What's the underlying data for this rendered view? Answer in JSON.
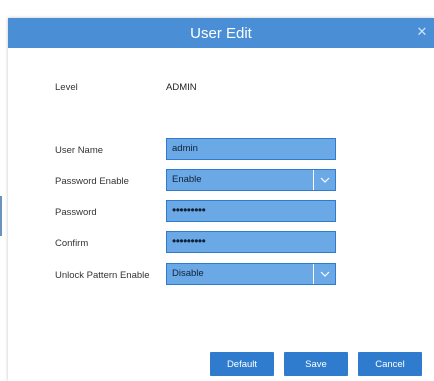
{
  "dialog": {
    "title": "User Edit",
    "close_glyph": "✕"
  },
  "form": {
    "level": {
      "label": "Level",
      "value": "ADMIN"
    },
    "user_name": {
      "label": "User Name",
      "value": "admin"
    },
    "password_enable": {
      "label": "Password Enable",
      "value": "Enable"
    },
    "password": {
      "label": "Password",
      "value": "•••••••••"
    },
    "confirm": {
      "label": "Confirm",
      "value": "•••••••••"
    },
    "unlock_pattern_enable": {
      "label": "Unlock Pattern Enable",
      "value": "Disable"
    }
  },
  "buttons": {
    "default_label": "Default",
    "save_label": "Save",
    "cancel_label": "Cancel"
  },
  "icons": {
    "close": "close-icon",
    "dropdown": "chevron-down-icon"
  },
  "colors": {
    "titlebar": "#4a8fd6",
    "field_fill": "#6aa8e6",
    "button": "#2f7ccf"
  }
}
